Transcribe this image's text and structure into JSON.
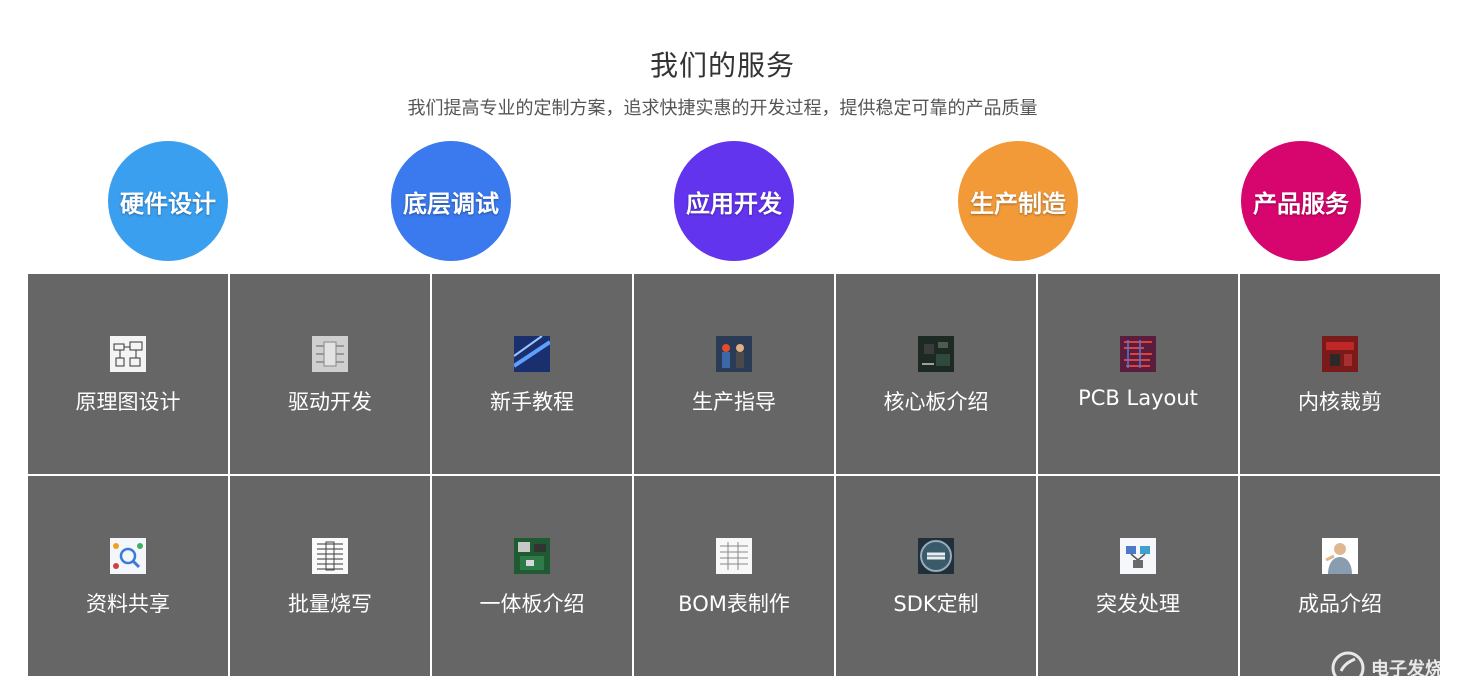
{
  "section": {
    "title": "我们的服务",
    "subtitle": "我们提高专业的定制方案，追求快捷实惠的开发过程，提供稳定可靠的产品质量"
  },
  "circles": [
    {
      "label": "硬件设计",
      "color": "#3b9ff0"
    },
    {
      "label": "底层调试",
      "color": "#3a79ee"
    },
    {
      "label": "应用开发",
      "color": "#6234ee"
    },
    {
      "label": "生产制造",
      "color": "#f39a38"
    },
    {
      "label": "产品服务",
      "color": "#d7066e"
    }
  ],
  "services": [
    {
      "label": "原理图设计",
      "icon": "schematic-thumb-icon"
    },
    {
      "label": "驱动开发",
      "icon": "driver-thumb-icon"
    },
    {
      "label": "新手教程",
      "icon": "tutorial-thumb-icon"
    },
    {
      "label": "生产指导",
      "icon": "production-thumb-icon"
    },
    {
      "label": "核心板介绍",
      "icon": "core-board-thumb-icon"
    },
    {
      "label": "PCB Layout",
      "icon": "pcb-thumb-icon"
    },
    {
      "label": "内核裁剪",
      "icon": "kernel-thumb-icon"
    },
    {
      "label": "资料共享",
      "icon": "share-thumb-icon"
    },
    {
      "label": "批量烧写",
      "icon": "flash-thumb-icon"
    },
    {
      "label": "一体板介绍",
      "icon": "all-in-one-board-thumb-icon"
    },
    {
      "label": "BOM表制作",
      "icon": "bom-thumb-icon"
    },
    {
      "label": "SDK定制",
      "icon": "sdk-thumb-icon"
    },
    {
      "label": "突发处理",
      "icon": "emergency-thumb-icon"
    },
    {
      "label": "成品介绍",
      "icon": "product-thumb-icon"
    }
  ],
  "watermark": {
    "text": "电子发烧友",
    "icon": "watermark-logo-icon"
  }
}
